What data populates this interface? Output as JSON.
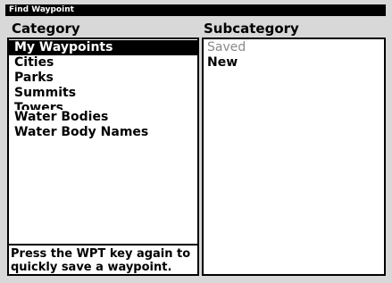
{
  "window": {
    "title": "Find Waypoint"
  },
  "category": {
    "header": "Category",
    "items": [
      {
        "label": "My Waypoints"
      },
      {
        "label": "Cities"
      },
      {
        "label": "Parks"
      },
      {
        "label": "Summits"
      },
      {
        "label": "Towers"
      },
      {
        "label": "Water Bodies"
      },
      {
        "label": "Water Body Names"
      }
    ],
    "selected_index": 0
  },
  "subcategory": {
    "header": "Subcategory",
    "items": [
      {
        "label": "Saved"
      },
      {
        "label": "New"
      }
    ]
  },
  "hint": {
    "line1": "Press the WPT key again to",
    "line2": "quickly save a waypoint."
  }
}
